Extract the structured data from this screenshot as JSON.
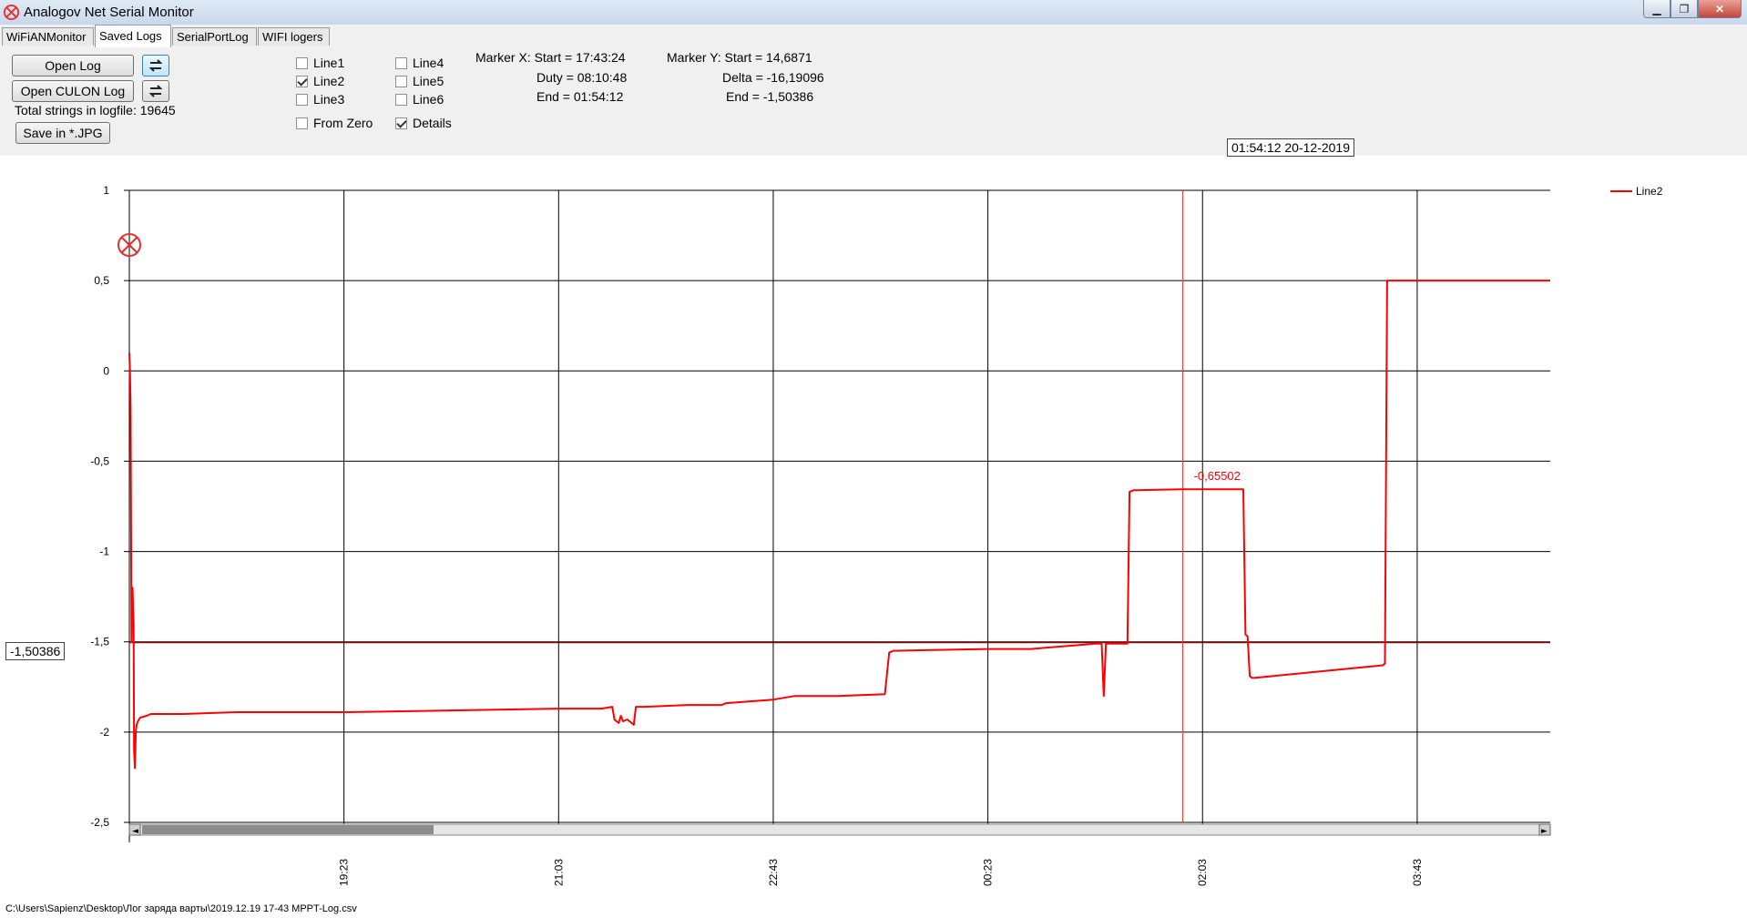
{
  "window": {
    "title": "Analogov Net Serial Monitor"
  },
  "tabs": [
    {
      "label": "WiFiANMonitor",
      "active": false
    },
    {
      "label": "Saved Logs",
      "active": true
    },
    {
      "label": "SerialPortLog",
      "active": false
    },
    {
      "label": "WIFI logers",
      "active": false
    }
  ],
  "toolbar": {
    "open_log": "Open Log",
    "open_culon_log": "Open CULON Log",
    "total_strings": "Total strings in logfile: 19645",
    "save_jpg": "Save in *.JPG"
  },
  "checkboxes": [
    {
      "label": "Line1",
      "checked": false
    },
    {
      "label": "Line2",
      "checked": true
    },
    {
      "label": "Line3",
      "checked": false
    },
    {
      "label": "Line4",
      "checked": false
    },
    {
      "label": "Line5",
      "checked": false
    },
    {
      "label": "Line6",
      "checked": false
    },
    {
      "label": "From Zero",
      "checked": false
    },
    {
      "label": "Details",
      "checked": true
    }
  ],
  "marker_x": {
    "start": "Marker X: Start = 17:43:24",
    "duty": "Duty = 08:10:48",
    "end": "End  = 01:54:12"
  },
  "marker_y": {
    "start": "Marker Y: Start = 14,6871",
    "delta": "Delta = -16,19096",
    "end": "End  = -1,50386"
  },
  "cursor_time_label": "01:54:12 20-12-2019",
  "cursor_y_label": "-1,50386",
  "point_label": "-0,65502",
  "status_path": "C:\\Users\\Sapienz\\Desktop\\Лог заряда варты\\2019.12.19 17-43 MPPT-Log.csv",
  "colors": {
    "series": "#ff0000",
    "marker_h": "#8b0000",
    "grid": "#000000"
  },
  "chart_data": {
    "type": "line",
    "title": "",
    "xlabel": "",
    "ylabel": "",
    "ylim": [
      -2.5,
      1
    ],
    "y_ticks": [
      "1",
      "0,5",
      "0",
      "-0,5",
      "-1",
      "-1,5",
      "-2",
      "-2,5"
    ],
    "y_tick_values": [
      1,
      0.5,
      0,
      -0.5,
      -1,
      -1.5,
      -2,
      -2.5
    ],
    "x_start_time": "17:43",
    "x_end_time": "04:45",
    "x_ticks": [
      "19:23",
      "21:03",
      "22:43",
      "00:23",
      "02:03",
      "03:43"
    ],
    "x_tick_minutes": [
      100,
      200,
      300,
      400,
      500,
      600
    ],
    "x_range_minutes": [
      0,
      662
    ],
    "legend": {
      "entries": [
        "Line2"
      ],
      "position": "top-right"
    },
    "grid": true,
    "cursor_x_minutes": 490.8,
    "cursor_y_value": -1.50386,
    "series": [
      {
        "name": "Line2",
        "x": [
          0,
          0.3,
          0.6,
          1,
          1.5,
          2,
          2.2,
          2.6,
          3,
          3.4,
          4,
          5,
          8,
          10,
          15,
          25,
          50,
          100,
          150,
          200,
          220,
          225,
          226,
          227,
          228,
          229,
          230,
          232,
          234,
          235,
          236,
          238,
          240,
          260,
          270,
          276,
          278,
          300,
          305,
          310,
          330,
          352,
          354,
          356,
          400,
          420,
          440,
          450,
          451,
          452,
          453,
          454,
          455,
          456,
          457,
          458,
          459,
          460,
          461,
          462,
          463,
          464,
          465,
          466,
          468,
          470,
          490.8,
          500,
          518,
          519,
          520,
          521,
          522,
          523,
          524,
          584,
          585,
          586,
          587,
          588
        ],
        "y": [
          0.1,
          0,
          -0.2,
          -1.5,
          -1.2,
          -1.4,
          -2.1,
          -2.2,
          -2.0,
          -1.96,
          -1.94,
          -1.92,
          -1.91,
          -1.9,
          -1.9,
          -1.9,
          -1.89,
          -1.89,
          -1.88,
          -1.87,
          -1.87,
          -1.86,
          -1.93,
          -1.94,
          -1.95,
          -1.91,
          -1.94,
          -1.93,
          -1.95,
          -1.96,
          -1.86,
          -1.86,
          -1.86,
          -1.85,
          -1.85,
          -1.85,
          -1.84,
          -1.82,
          -1.81,
          -1.8,
          -1.8,
          -1.79,
          -1.56,
          -1.55,
          -1.54,
          -1.54,
          -1.52,
          -1.51,
          -1.51,
          -1.51,
          -1.51,
          -1.8,
          -1.51,
          -1.51,
          -1.51,
          -1.51,
          -1.51,
          -1.51,
          -1.51,
          -1.51,
          -1.51,
          -1.51,
          -1.51,
          -0.67,
          -0.66,
          -0.66,
          -0.655,
          -0.655,
          -0.655,
          -0.655,
          -1.46,
          -1.47,
          -1.69,
          -1.7,
          -1.7,
          -1.63,
          -1.62,
          0.5,
          0.5,
          0.5
        ]
      }
    ],
    "series_tail": {
      "x": [
        588,
        662
      ],
      "y": [
        0.5,
        0.5
      ]
    }
  }
}
